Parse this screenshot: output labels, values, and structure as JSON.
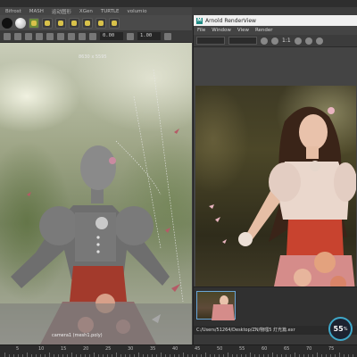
{
  "maya": {
    "shelf_tabs": [
      "Bifrost",
      "MASH",
      "运动图形",
      "XGen",
      "TURTLE",
      "volumio"
    ],
    "shelf_icons": [
      "sphere-black",
      "sphere-white",
      "shelf-tool",
      "shelf-tool",
      "shelf-tool",
      "shelf-tool",
      "shelf-tool",
      "shelf-tool",
      "shelf-tool"
    ],
    "viewport_toolbar": {
      "field_1": "0.00",
      "field_2": "1.00"
    },
    "viewport": {
      "resolution": "8630 x 5595",
      "camera_label": "camera1 (mesh1.poly)"
    }
  },
  "render_view": {
    "title": "Arnold RenderView",
    "menu": [
      "File",
      "Window",
      "View",
      "Render"
    ],
    "ratio": "1:1",
    "file_path": "C:/Users/51264/Desktop/ZN/物嗤5 灯光篇.exr"
  },
  "timeline": {
    "labels": [
      "5",
      "10",
      "15",
      "20",
      "25",
      "30",
      "35",
      "40",
      "45",
      "50",
      "55",
      "60",
      "65",
      "70",
      "75"
    ]
  },
  "perf": {
    "value": "55",
    "unit": "%"
  },
  "colors": {
    "accent": "#3fa7c8",
    "arnold": "#1f8a84"
  }
}
